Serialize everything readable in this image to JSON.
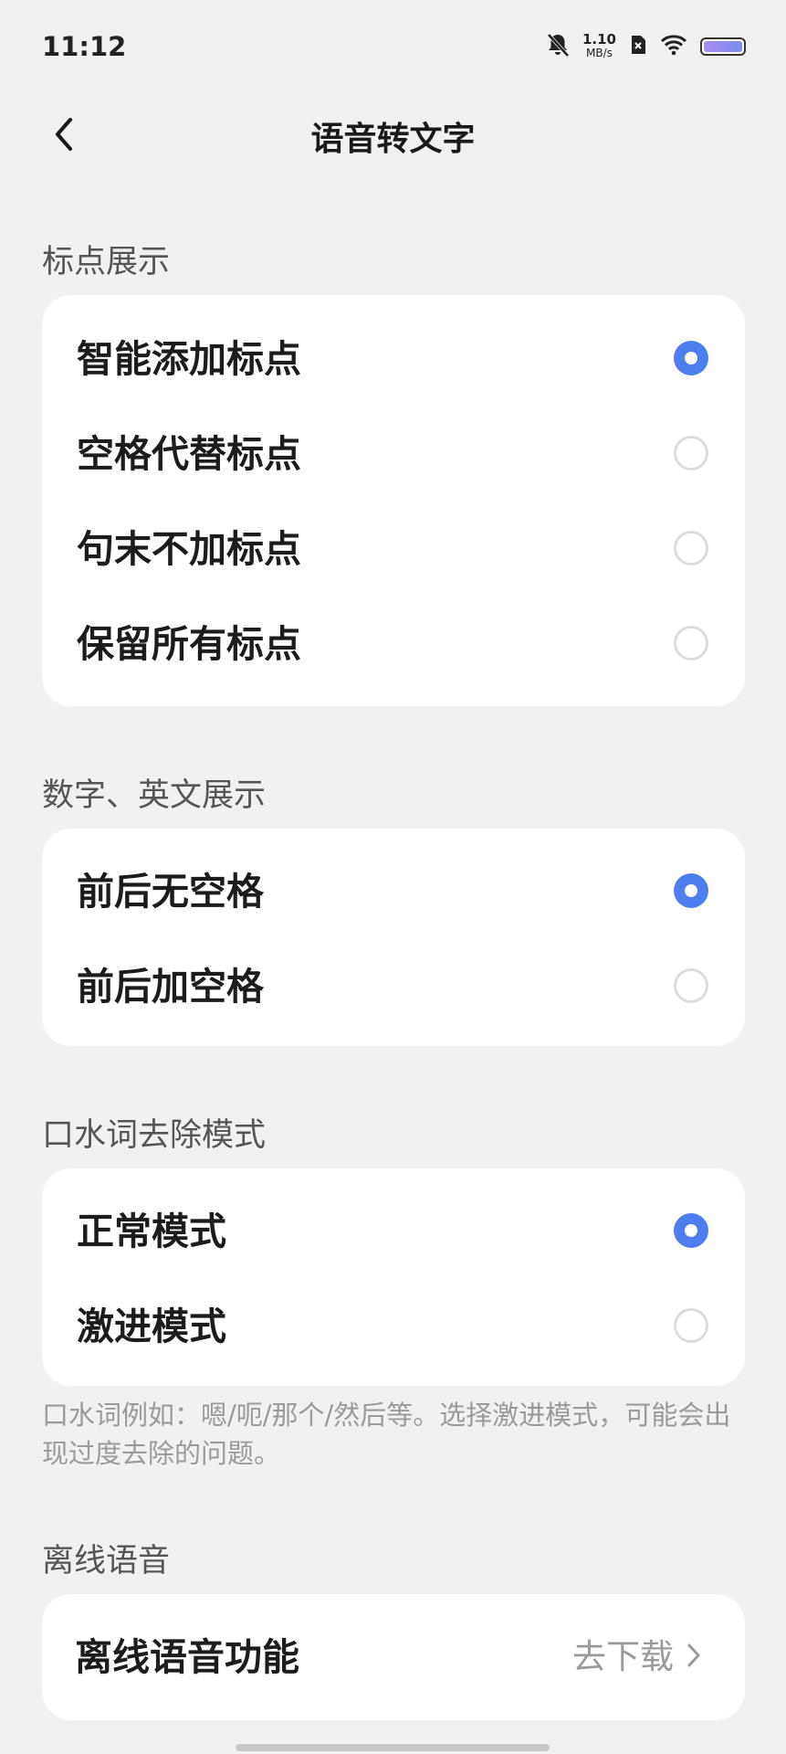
{
  "status": {
    "time": "11:12",
    "net_speed_value": "1.10",
    "net_speed_unit": "MB/s"
  },
  "header": {
    "title": "语音转文字"
  },
  "punctuation": {
    "title": "标点展示",
    "options": [
      {
        "label": "智能添加标点",
        "selected": true
      },
      {
        "label": "空格代替标点",
        "selected": false
      },
      {
        "label": "句末不加标点",
        "selected": false
      },
      {
        "label": "保留所有标点",
        "selected": false
      }
    ]
  },
  "numbers": {
    "title": "数字、英文展示",
    "options": [
      {
        "label": "前后无空格",
        "selected": true
      },
      {
        "label": "前后加空格",
        "selected": false
      }
    ]
  },
  "filler": {
    "title": "口水词去除模式",
    "options": [
      {
        "label": "正常模式",
        "selected": true
      },
      {
        "label": "激进模式",
        "selected": false
      }
    ],
    "note": "口水词例如：嗯/呃/那个/然后等。选择激进模式，可能会出现过度去除的问题。"
  },
  "offline": {
    "title": "离线语音",
    "item_label": "离线语音功能",
    "item_action": "去下载"
  },
  "colors": {
    "accent": "#4d7ef0",
    "background": "#f1f1f1",
    "card": "#ffffff"
  }
}
